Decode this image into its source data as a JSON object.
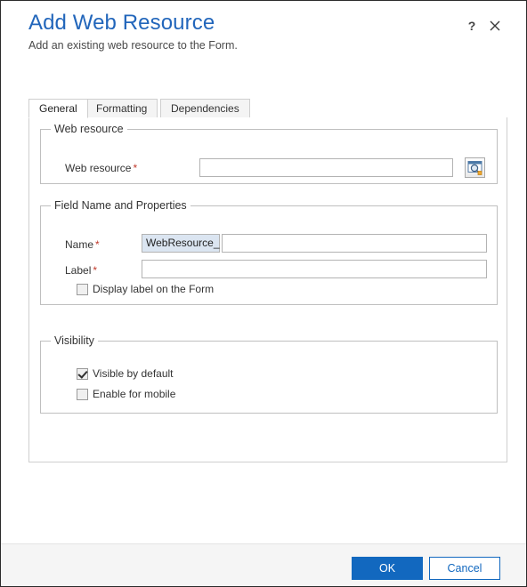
{
  "window": {
    "title": "Add Web Resource",
    "subtitle": "Add an existing web resource to the Form.",
    "help_icon": "question-mark-icon",
    "close_icon": "close-x-icon",
    "accent_color": "#1268bf",
    "title_color": "#2266bb",
    "required_marker_color": "#c0392b"
  },
  "tabs": [
    {
      "label": "General",
      "active": true
    },
    {
      "label": "Formatting",
      "active": false
    },
    {
      "label": "Dependencies",
      "active": false
    }
  ],
  "sections": {
    "web_resource": {
      "legend": "Web resource",
      "field": {
        "label": "Web resource",
        "required_marker": "*",
        "value": "",
        "placeholder": ""
      },
      "lookup_button": {
        "icon": "lookup-search-icon",
        "title": "Lookup"
      }
    },
    "field_name_and_properties": {
      "legend": "Field Name and Properties",
      "name": {
        "label": "Name",
        "required_marker": "*",
        "prefix": "WebResource_",
        "value": "",
        "placeholder": ""
      },
      "label_field": {
        "label": "Label",
        "required_marker": "*",
        "value": "",
        "placeholder": ""
      },
      "display_label_checkbox": {
        "label": "Display label on the Form",
        "checked": false
      }
    },
    "visibility": {
      "legend": "Visibility",
      "visible_by_default": {
        "label": "Visible by default",
        "checked": true
      },
      "enable_for_mobile": {
        "label": "Enable for mobile",
        "checked": false
      }
    }
  },
  "footer": {
    "ok_label": "OK",
    "cancel_label": "Cancel"
  }
}
